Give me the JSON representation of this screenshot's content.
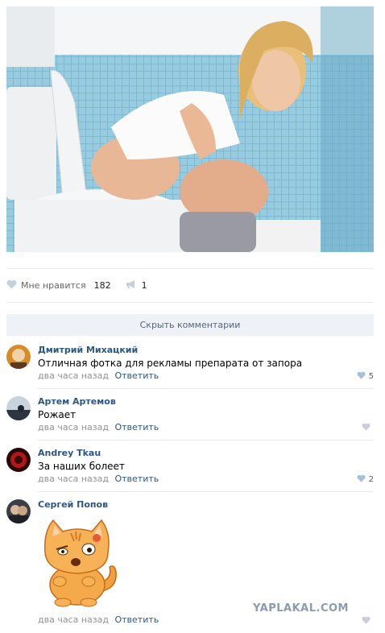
{
  "post": {
    "likes_label": "Мне нравится",
    "likes_count": "182",
    "shares_count": "1",
    "hide_comments_label": "Скрыть комментарии"
  },
  "comments": [
    {
      "author": "Дмитрий Михацкий",
      "text": "Отличная фотка для рекламы препарата от запора",
      "time": "два часа назад",
      "reply": "Ответить",
      "likes": "5"
    },
    {
      "author": "Артем Артемов",
      "text": "Рожает",
      "time": "два часа назад",
      "reply": "Ответить",
      "likes": ""
    },
    {
      "author": "Andrey Tkau",
      "text": "За наших болеет",
      "time": "два часа назад",
      "reply": "Ответить",
      "likes": "2"
    },
    {
      "author": "Сергей Попов",
      "text": "",
      "time": "два часа назад",
      "reply": "Ответить",
      "likes": ""
    }
  ],
  "watermark": "YAPLAKAL.COM",
  "colors": {
    "link": "#2a5885",
    "muted": "#939393",
    "bar": "#eef1f5",
    "heart": "#8fadc8"
  },
  "icons": [
    "heart-icon",
    "megaphone-icon",
    "cat-sticker"
  ]
}
